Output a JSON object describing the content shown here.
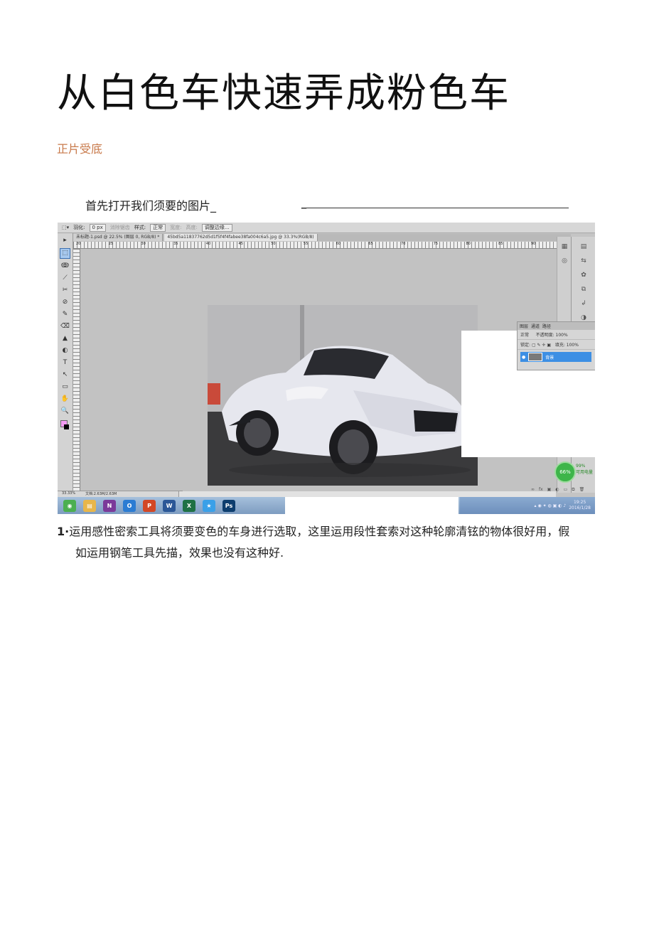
{
  "document": {
    "title": "从白色车快速弄成粉色车",
    "subtitle": "正片受底",
    "intro": "首先打开我们须要的图片_",
    "intro_dash": "_",
    "step1_number": "1·",
    "step1_line1": "运用感性密索工具将须要变色的车身进行选取，这里运用段性套索对这种轮廓清铉的物体很好用，假",
    "step1_line2": "如运用钢笔工具先描，效果也没有这种好."
  },
  "screenshot": {
    "options_bar": {
      "feather_label": "羽化:",
      "feather_value": "0 px",
      "antialias_label": "消除锯齿",
      "style_label": "样式:",
      "style_value": "正常",
      "width_label": "宽度:",
      "height_label": "高度:",
      "refine_label": "调整边缘..."
    },
    "tabs": [
      "未标题-1.psd @ 22.5% (图层 0, RGB/8) *",
      "45bd5a11837762d5d1f5f4f4fabee38fa004c6a5.jpg @ 33.3%(RGB/8)"
    ],
    "ruler_numbers": [
      "20",
      "25",
      "30",
      "35",
      "40",
      "45",
      "50",
      "55",
      "60",
      "65",
      "70",
      "75",
      "80",
      "85",
      "90",
      "95"
    ],
    "tools": [
      "▸",
      "⬚",
      "ↂ",
      "⟋",
      "✂",
      "⊘",
      "✎",
      "⌫",
      "▲",
      "◐",
      "T",
      "↖",
      "▭",
      "✋",
      "🔍"
    ],
    "layers_panel": {
      "tabs": [
        "图层",
        "通道",
        "路径"
      ],
      "blend_mode": "正常",
      "opacity_label": "不透明度:",
      "opacity_value": "100%",
      "lock_label": "锁定:",
      "fill_label": "填充:",
      "fill_value": "100%",
      "layer_name": "背景"
    },
    "gauge": {
      "value": "66%",
      "side_percent": "99%",
      "side_label": "可用电量"
    },
    "status": {
      "zoom": "33.33%",
      "doc": "文档:2.63M/2.63M"
    },
    "taskbar_apps": [
      {
        "label": "◉",
        "color": "#4caf50"
      },
      {
        "label": "▤",
        "color": "#e8b64a"
      },
      {
        "label": "N",
        "color": "#7b3a9a"
      },
      {
        "label": "O",
        "color": "#2b7cd3"
      },
      {
        "label": "P",
        "color": "#d24726"
      },
      {
        "label": "W",
        "color": "#2b5797"
      },
      {
        "label": "X",
        "color": "#1e7145"
      },
      {
        "label": "★",
        "color": "#3aa0e8"
      },
      {
        "label": "Ps",
        "color": "#0d3d6e"
      }
    ],
    "clock": {
      "time": "19:25",
      "date": "2016/1/28"
    }
  }
}
